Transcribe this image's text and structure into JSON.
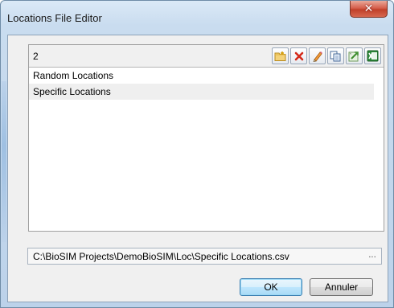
{
  "window": {
    "title": "Locations File Editor",
    "close_label": "✕"
  },
  "list": {
    "count": "2",
    "items": [
      {
        "label": "Random Locations",
        "selected": false
      },
      {
        "label": "Specific Locations",
        "selected": true
      }
    ],
    "toolbar": [
      {
        "name": "new-folder-icon",
        "tooltip": ""
      },
      {
        "name": "delete-icon",
        "tooltip": ""
      },
      {
        "name": "edit-pencil-icon",
        "tooltip": ""
      },
      {
        "name": "copy-icon",
        "tooltip": ""
      },
      {
        "name": "import-icon",
        "tooltip": ""
      },
      {
        "name": "excel-icon",
        "tooltip": ""
      }
    ]
  },
  "path": {
    "value": "C:\\BioSIM Projects\\DemoBioSIM\\Loc\\Specific Locations.csv",
    "browse_label": "..."
  },
  "buttons": {
    "ok_label": "OK",
    "cancel_label": "Annuler"
  },
  "colors": {
    "title_bar": "#bcd2ea",
    "close_red": "#d6604d",
    "selection": "#efefef",
    "ok_accent": "#3c7fb1"
  }
}
